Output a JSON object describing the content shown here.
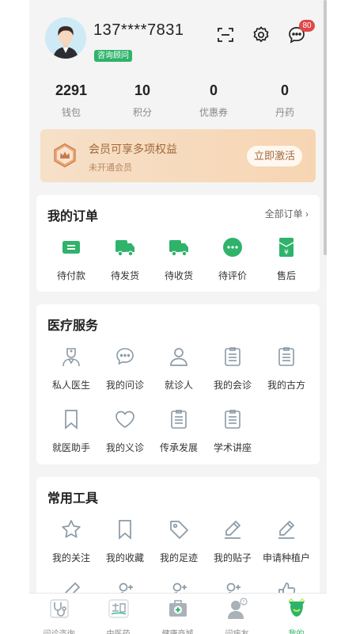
{
  "header": {
    "phone": "137****7831",
    "role_badge": "咨询顾问",
    "message_count": "80",
    "icons": [
      "scan-icon",
      "gear-icon",
      "message-icon"
    ]
  },
  "stats": [
    {
      "value": "2291",
      "label": "钱包"
    },
    {
      "value": "10",
      "label": "积分"
    },
    {
      "value": "0",
      "label": "优惠券"
    },
    {
      "value": "0",
      "label": "丹药"
    }
  ],
  "member": {
    "title": "会员可享多项权益",
    "subtitle": "未开通会员",
    "button": "立即激活"
  },
  "orders": {
    "title": "我的订单",
    "all_link": "全部订单",
    "items": [
      {
        "label": "待付款",
        "icon": "ticket-icon"
      },
      {
        "label": "待发货",
        "icon": "truck-icon"
      },
      {
        "label": "待收货",
        "icon": "truck-icon"
      },
      {
        "label": "待评价",
        "icon": "chat-bubble-icon"
      },
      {
        "label": "售后",
        "icon": "yen-pouch-icon"
      }
    ]
  },
  "medical": {
    "title": "医疗服务",
    "items": [
      {
        "label": "私人医生",
        "icon": "doctor-icon"
      },
      {
        "label": "我的问诊",
        "icon": "chat-icon"
      },
      {
        "label": "就诊人",
        "icon": "person-icon"
      },
      {
        "label": "我的会诊",
        "icon": "clipboard-icon"
      },
      {
        "label": "我的古方",
        "icon": "clipboard-icon"
      },
      {
        "label": "就医助手",
        "icon": "bookmark-icon"
      },
      {
        "label": "我的义诊",
        "icon": "heart-icon"
      },
      {
        "label": "传承发展",
        "icon": "clipboard-icon"
      },
      {
        "label": "学术讲座",
        "icon": "clipboard-icon"
      }
    ]
  },
  "tools": {
    "title": "常用工具",
    "items": [
      {
        "label": "我的关注",
        "icon": "star-icon"
      },
      {
        "label": "我的收藏",
        "icon": "bookmark-icon"
      },
      {
        "label": "我的足迹",
        "icon": "tag-icon"
      },
      {
        "label": "我的贴子",
        "icon": "pencil-icon"
      },
      {
        "label": "申请种植户",
        "icon": "pencil-icon"
      }
    ]
  },
  "tabbar": {
    "active": "我的",
    "accent": "#2fb36b",
    "items": [
      {
        "label": "问诊咨询",
        "icon": "stethoscope-icon"
      },
      {
        "label": "中医药",
        "icon": "herb-icon"
      },
      {
        "label": "健康商城",
        "icon": "medkit-icon"
      },
      {
        "label": "问病友",
        "icon": "patient-icon"
      },
      {
        "label": "我的",
        "icon": "profile-icon"
      }
    ]
  }
}
